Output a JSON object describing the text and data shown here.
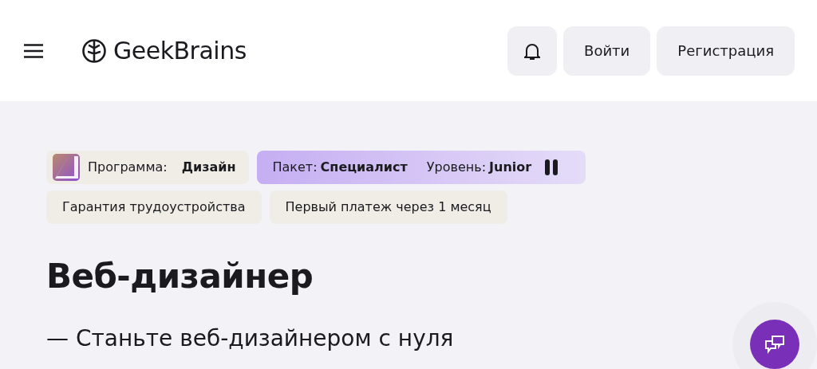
{
  "header": {
    "logo_text": "GeekBrains",
    "buttons": [
      "Войти",
      "Регистрация"
    ]
  },
  "program_tag": {
    "label": "Программа:",
    "value": "Дизайн"
  },
  "package_tag": {
    "package_label": "Пакет:",
    "package_value": "Специалист",
    "level_label": "Уровень:",
    "level_value": "Junior"
  },
  "feature_tags": [
    "Гарантия трудоустройства",
    "Первый платеж через 1 месяц"
  ],
  "title": "Веб-дизайнер",
  "subtitle": "— Станьте веб-дизайнером с нуля"
}
